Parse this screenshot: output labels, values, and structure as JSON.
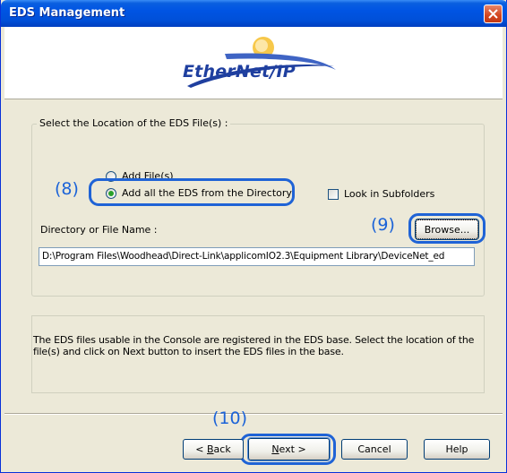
{
  "window": {
    "title": "EDS Management"
  },
  "header": {
    "logo_text": "EtherNet/IP"
  },
  "location_group": {
    "legend": "Select the Location of the EDS File(s) :",
    "options": [
      {
        "label": "Add File(s)",
        "checked": false
      },
      {
        "label": "Add all the EDS from the Directory",
        "checked": true
      }
    ],
    "subfolders": {
      "label": "Look in Subfolders",
      "checked": false
    },
    "dir_label": "Directory or File Name :",
    "dir_value": "D:\\Program Files\\Woodhead\\Direct-Link\\applicomIO2.3\\Equipment Library\\DeviceNet_ed",
    "browse": "Browse..."
  },
  "info": {
    "text": "The EDS files usable in the Console are registered in the EDS base. Select the location of the file(s) and click on Next button to insert the EDS files in the base."
  },
  "annotations": {
    "step8": "(8)",
    "step9": "(9)",
    "step10": "(10)"
  },
  "buttons": {
    "back": {
      "mnemonic": "B",
      "rest": "ack",
      "prefix": "< "
    },
    "next": {
      "mnemonic": "N",
      "rest": "ext",
      "suffix": " >"
    },
    "cancel": "Cancel",
    "help": "Help"
  },
  "colors": {
    "annotation": "#1f63d6",
    "titlebar": "#0054e3"
  }
}
